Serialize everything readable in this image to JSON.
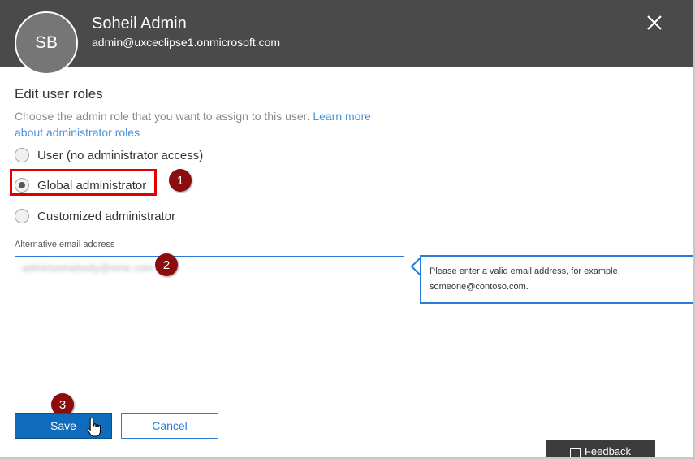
{
  "header": {
    "initials": "SB",
    "name": "Soheil Admin",
    "email": "admin@uxceclipse1.onmicrosoft.com",
    "close_icon": "close-icon"
  },
  "roles": {
    "title": "Edit user roles",
    "description": "Choose the admin role that you want to assign to this user.",
    "learn_more": "Learn more about administrator roles",
    "options": [
      {
        "label": "User (no administrator access)",
        "checked": false
      },
      {
        "label": "Global administrator",
        "checked": true
      },
      {
        "label": "Customized administrator",
        "checked": false
      }
    ]
  },
  "alt_email": {
    "label": "Alternative email address",
    "value": "adminsomebody@ome.com"
  },
  "validation": {
    "message": "Please enter a valid email address, for example, someone@contoso.com."
  },
  "steps": [
    "1",
    "2",
    "3"
  ],
  "actions": {
    "save": "Save",
    "cancel": "Cancel"
  },
  "feedback": {
    "label": "Feedback",
    "icon": "feedback-icon"
  },
  "colors": {
    "header_bg": "#4a4a4a",
    "accent": "#0f6cbd",
    "highlight": "#e00000",
    "step_badge": "#8b0d0d"
  }
}
